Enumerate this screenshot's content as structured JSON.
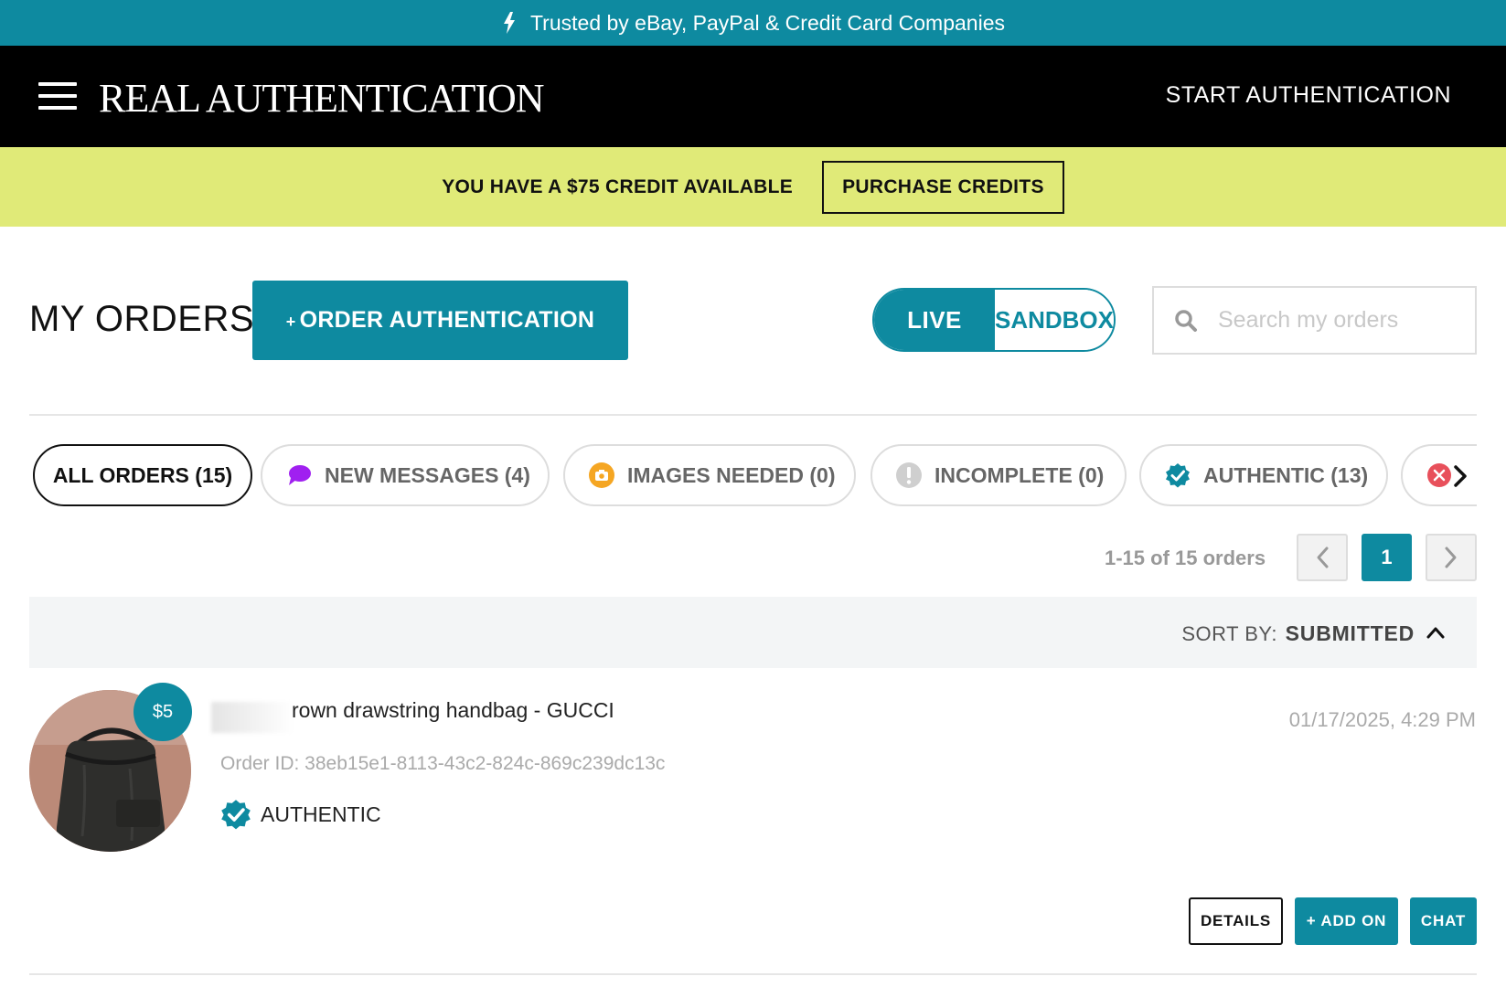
{
  "trust_bar": {
    "text": "Trusted by eBay, PayPal & Credit Card Companies",
    "icon": "lightning-icon"
  },
  "header": {
    "logo": "REAL AUTHENTICATION",
    "cta": "START AUTHENTICATION",
    "menu_icon": "hamburger-menu-icon"
  },
  "credit_bar": {
    "text": "YOU HAVE A $75 CREDIT AVAILABLE",
    "button": "PURCHASE CREDITS"
  },
  "orders": {
    "title": "MY ORDERS",
    "order_button_plus": "+",
    "order_button": "ORDER AUTHENTICATION",
    "mode": {
      "live": "LIVE",
      "sandbox": "SANDBOX",
      "selected": "LIVE"
    },
    "search_placeholder": "Search my orders"
  },
  "filters": [
    {
      "label": "ALL ORDERS (15)",
      "icon": "",
      "active": true
    },
    {
      "label": "NEW MESSAGES (4)",
      "icon": "chat-bubble-icon",
      "active": false
    },
    {
      "label": "IMAGES NEEDED (0)",
      "icon": "camera-icon",
      "active": false
    },
    {
      "label": "INCOMPLETE (0)",
      "icon": "exclamation-icon",
      "active": false
    },
    {
      "label": "AUTHENTIC (13)",
      "icon": "verified-check-icon",
      "active": false
    },
    {
      "label": "",
      "icon": "x-circle-icon",
      "active": false
    }
  ],
  "pagination": {
    "summary": "1-15 of 15 orders",
    "current_page": "1"
  },
  "sort": {
    "label": "SORT BY:",
    "value": "SUBMITTED",
    "direction": "ascending"
  },
  "order_item": {
    "title": "rown drawstring handbag - GUCCI",
    "price": "$5",
    "order_id": "Order ID: 38eb15e1-8113-43c2-824c-869c239dc13c",
    "date": "01/17/2025, 4:29 PM",
    "status": "AUTHENTIC",
    "actions": {
      "details": "DETAILS",
      "add_on": "+ ADD ON",
      "chat": "CHAT"
    }
  },
  "colors": {
    "brand": "#0e8aa0",
    "credit_bar": "#e0ea78",
    "header": "#000000",
    "messages": "#a020f0",
    "images_needed": "#f5a623",
    "rejected": "#e8505b"
  }
}
